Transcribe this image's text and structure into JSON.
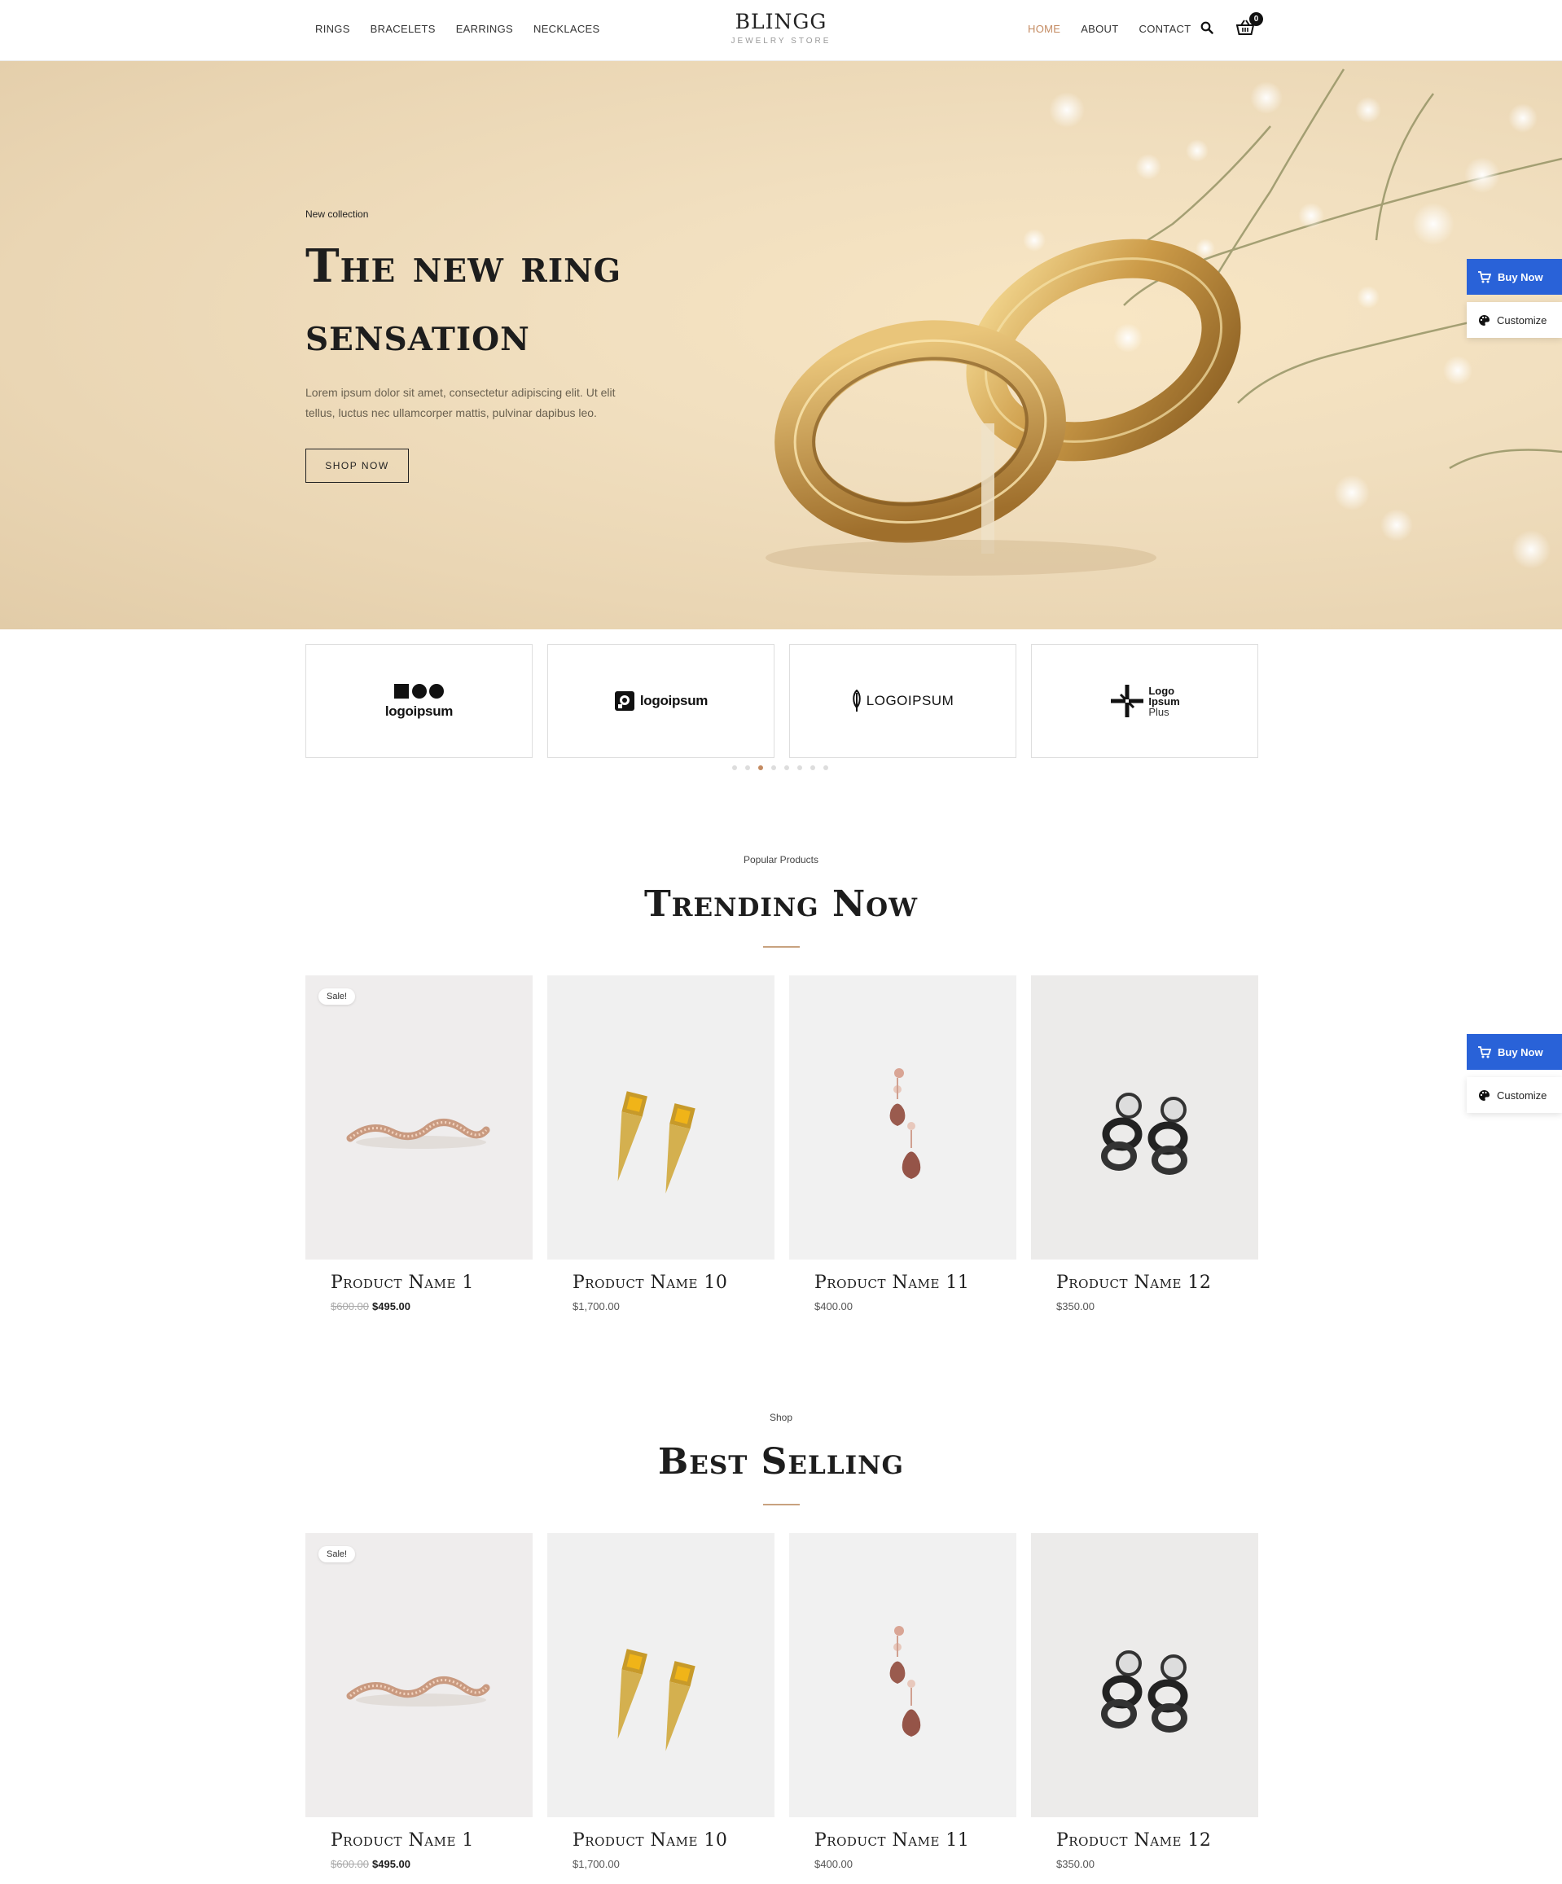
{
  "header": {
    "nav_left": [
      "RINGS",
      "BRACELETS",
      "EARRINGS",
      "NECKLACES"
    ],
    "brand_title": "BLINGG",
    "brand_subtitle": "JEWELRY STORE",
    "nav_right": [
      "HOME",
      "ABOUT",
      "CONTACT"
    ],
    "cart_count": "0",
    "active_color": "#c48b62"
  },
  "hero": {
    "eyebrow": "New collection",
    "title": "The new ring sensation",
    "text": "Lorem ipsum dolor sit amet, consectetur adipiscing elit. Ut elit tellus, luctus nec ullamcorper mattis, pulvinar dapibus leo.",
    "button": "SHOP NOW"
  },
  "side_buttons": {
    "buy_now": "Buy Now",
    "customize": "Customize",
    "buy_color": "#2962d8"
  },
  "logos": [
    {
      "text": "logoipsum",
      "icon": "circles-logo-icon"
    },
    {
      "text": "logoipsum",
      "icon": "square-q-logo-icon"
    },
    {
      "text": "LOGOIPSUM",
      "icon": "feather-logo-icon"
    },
    {
      "text": "Logo Ipsum Plus",
      "line1": "Logo",
      "line2": "Ipsum",
      "line3": "Plus",
      "icon": "plus-logo-icon"
    }
  ],
  "carousel": {
    "count": 8,
    "active": 2
  },
  "trending": {
    "eyebrow": "Popular Products",
    "title": "Trending Now",
    "products": [
      {
        "name": "Product Name 1",
        "old_price": "$600.00",
        "price": "$495.00",
        "sale": "Sale!"
      },
      {
        "name": "Product Name 10",
        "price": "$1,700.00"
      },
      {
        "name": "Product Name 11",
        "price": "$400.00"
      },
      {
        "name": "Product Name 12",
        "price": "$350.00"
      }
    ]
  },
  "best": {
    "eyebrow": "Shop",
    "title": "Best Selling",
    "products": [
      {
        "name": "Product Name 1",
        "old_price": "$600.00",
        "price": "$495.00",
        "sale": "Sale!"
      },
      {
        "name": "Product Name 10",
        "price": "$1,700.00"
      },
      {
        "name": "Product Name 11",
        "price": "$400.00"
      },
      {
        "name": "Product Name 12",
        "price": "$350.00"
      }
    ]
  }
}
